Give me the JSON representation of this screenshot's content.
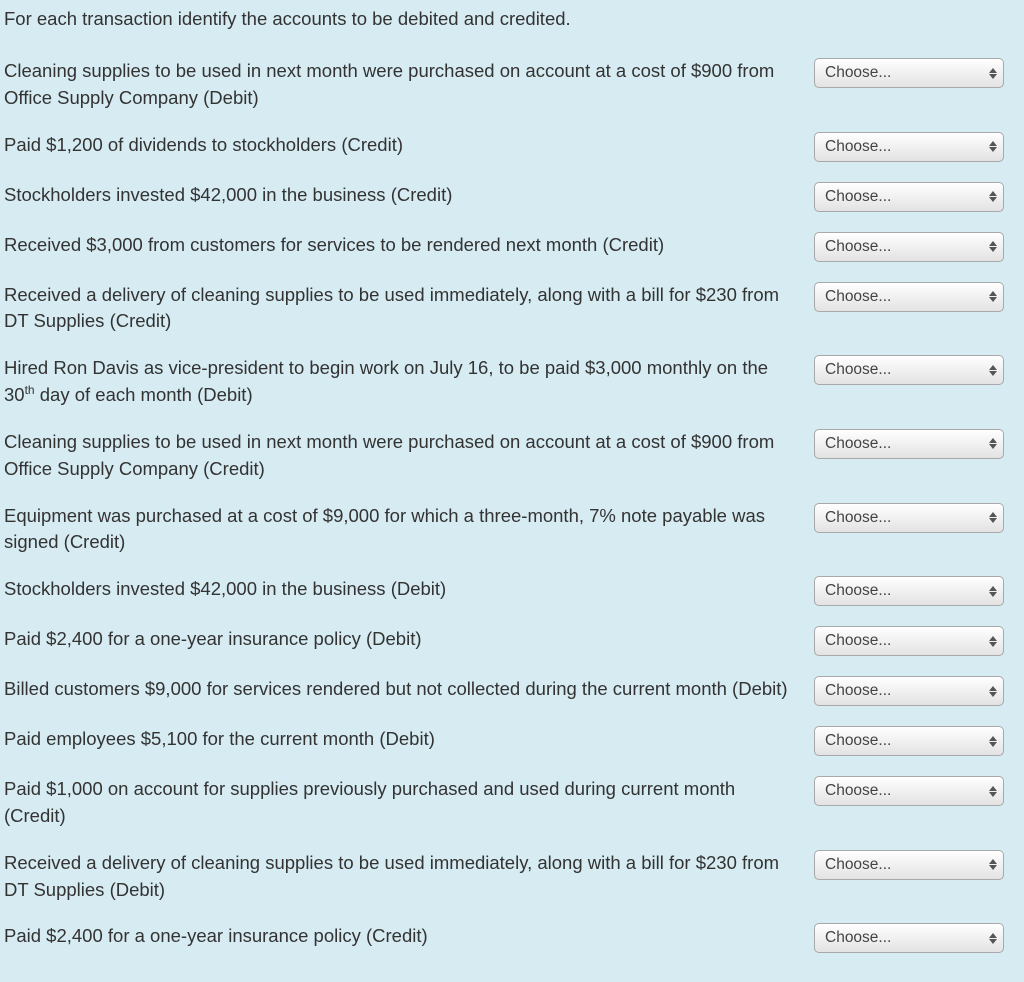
{
  "instruction": "For each transaction identify the accounts to be debited and credited.",
  "selectPlaceholder": "Choose...",
  "questions": [
    {
      "text": "Cleaning supplies to be used in next month were purchased on account at a cost of $900 from Office Supply Company (Debit)"
    },
    {
      "text": "Paid $1,200 of dividends to stockholders (Credit)"
    },
    {
      "text": "Stockholders invested $42,000 in the business (Credit)"
    },
    {
      "text": "Received $3,000 from customers for services to be rendered next month (Credit)"
    },
    {
      "text": "Received a delivery of cleaning supplies to be used immediately, along with a bill for $230 from DT Supplies (Credit)"
    },
    {
      "textPre": "Hired Ron Davis as vice-president to begin work on July 16, to be paid $3,000 monthly on the 30",
      "sup": "th",
      "textPost": " day of each month (Debit)"
    },
    {
      "text": "Cleaning supplies to be used in next month were purchased on account at a cost of $900 from Office Supply Company (Credit)"
    },
    {
      "text": "Equipment was purchased at a cost of $9,000 for which a three-month, 7% note payable was signed (Credit)"
    },
    {
      "text": "Stockholders invested $42,000 in the business (Debit)"
    },
    {
      "text": "Paid $2,400 for a one-year insurance policy (Debit)"
    },
    {
      "text": "Billed customers $9,000 for services rendered but not collected during the current month (Debit)"
    },
    {
      "text": "Paid employees $5,100 for the current month (Debit)"
    },
    {
      "text": "Paid $1,000 on account for supplies previously purchased and used during current month (Credit)"
    },
    {
      "text": "Received a delivery of cleaning supplies to be used immediately, along with a bill for $230 from DT Supplies (Debit)"
    },
    {
      "text": "Paid $2,400 for a one-year insurance policy (Credit)"
    }
  ]
}
